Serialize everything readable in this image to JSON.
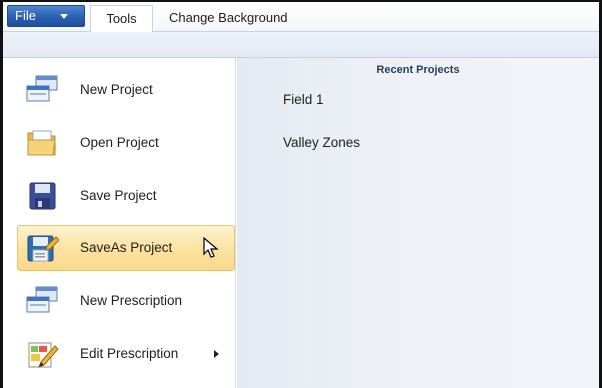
{
  "menubar": {
    "file_label": "File",
    "tabs": [
      {
        "label": "Tools"
      },
      {
        "label": "Change Background"
      }
    ]
  },
  "menu": {
    "items": [
      {
        "label": "New Project",
        "icon": "new-project-icon"
      },
      {
        "label": "Open Project",
        "icon": "folder-open-icon"
      },
      {
        "label": "Save Project",
        "icon": "floppy-disk-icon"
      },
      {
        "label": "SaveAs Project",
        "icon": "floppy-save-as-icon",
        "highlighted": true
      },
      {
        "label": "New Prescription",
        "icon": "new-prescription-icon"
      },
      {
        "label": "Edit Prescription",
        "icon": "edit-prescription-icon",
        "has_submenu": true
      }
    ]
  },
  "recent": {
    "title": "Recent Projects",
    "items": [
      {
        "label": "Field 1"
      },
      {
        "label": "Valley Zones"
      }
    ]
  },
  "colors": {
    "file_button": "#2b5fb1",
    "hover_highlight": "#fbe3a2",
    "panel_bg": "#e9eef5"
  }
}
